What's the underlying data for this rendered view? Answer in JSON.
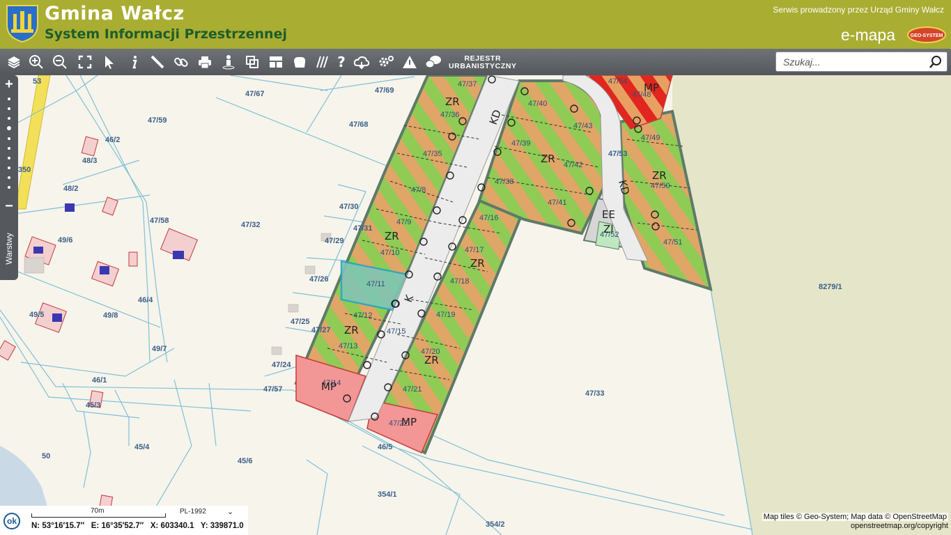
{
  "header": {
    "title": "Gmina Wałcz",
    "subtitle": "System Informacji Przestrzennej",
    "service_text": "Serwis prowadzony przez Urząd Gminy Wałcz",
    "brand": "e-mapa",
    "partner_logo": "GEO-SYSTEM"
  },
  "toolbar": {
    "tools": [
      "layers-icon",
      "zoom-in-tool-icon",
      "zoom-out-tool-icon",
      "full-extent-icon",
      "select-arrow-icon",
      "info-icon",
      "measure-icon",
      "link-icon",
      "print-icon",
      "street-view-icon",
      "compare-icon",
      "layout-icon",
      "shape-icon",
      "hatch-icon",
      "help-icon",
      "cloud-icon",
      "settings-icon",
      "warning-icon",
      "comments-icon"
    ],
    "registry_line1": "REJESTR",
    "registry_line2": "URBANISTYCZNY"
  },
  "search": {
    "placeholder": "Szukaj..."
  },
  "zoom": {
    "in": "+",
    "out": "−"
  },
  "layers_tab": "Warstwy",
  "map": {
    "parcels": [
      "53",
      "47/67",
      "47/69",
      "47/59",
      "47/68",
      "46/2",
      "48/3",
      "350",
      "48/2",
      "47/58",
      "47/32",
      "47/30",
      "47/31",
      "49/6",
      "47/29",
      "49/8",
      "46/4",
      "47/26",
      "49/5",
      "47/25",
      "47/27",
      "49/7",
      "47/24",
      "46/1",
      "47/57",
      "45/3",
      "45/4",
      "50",
      "45/6",
      "46/5",
      "354/1",
      "354/2",
      "47/33",
      "8279/1",
      "47/53"
    ],
    "plots": [
      "47/37",
      "47/36",
      "47/35",
      "47/8",
      "47/9",
      "47/10",
      "47/11",
      "47/12",
      "47/13",
      "47/14",
      "47/15",
      "47/16",
      "47/17",
      "47/18",
      "47/19",
      "47/20",
      "47/21",
      "47/22",
      "47/40",
      "47/39",
      "47/38",
      "47/43",
      "47/42",
      "47/41",
      "47/54",
      "47/48",
      "47/49",
      "47/50",
      "47/51",
      "47/52"
    ],
    "zones": [
      "ZR",
      "ZR",
      "ZR",
      "ZR",
      "ZR",
      "ZR",
      "ZR",
      "MP",
      "MP",
      "MP",
      "KD",
      "KD",
      "K",
      "EE",
      "ZI"
    ]
  },
  "status": {
    "ok": "ok",
    "scale": "70m",
    "crs": "PL-1992",
    "coords": "N: 53°16′15.7″   E: 16°35′52.7″   X: 603340.1   Y: 339871.0"
  },
  "attribution": "Map tiles © Geo-System; Map data © OpenStreetMap",
  "attribution2": "openstreetmap.org/copyright",
  "colors": {
    "header": "#a9ad32",
    "toolbar": "#5f6267",
    "zr_green": "#8bc34a",
    "zr_orange": "#e0a05a",
    "mp_pink": "#f19191",
    "road": "#e6e6e6",
    "parcel_line": "#6fb3c9"
  }
}
